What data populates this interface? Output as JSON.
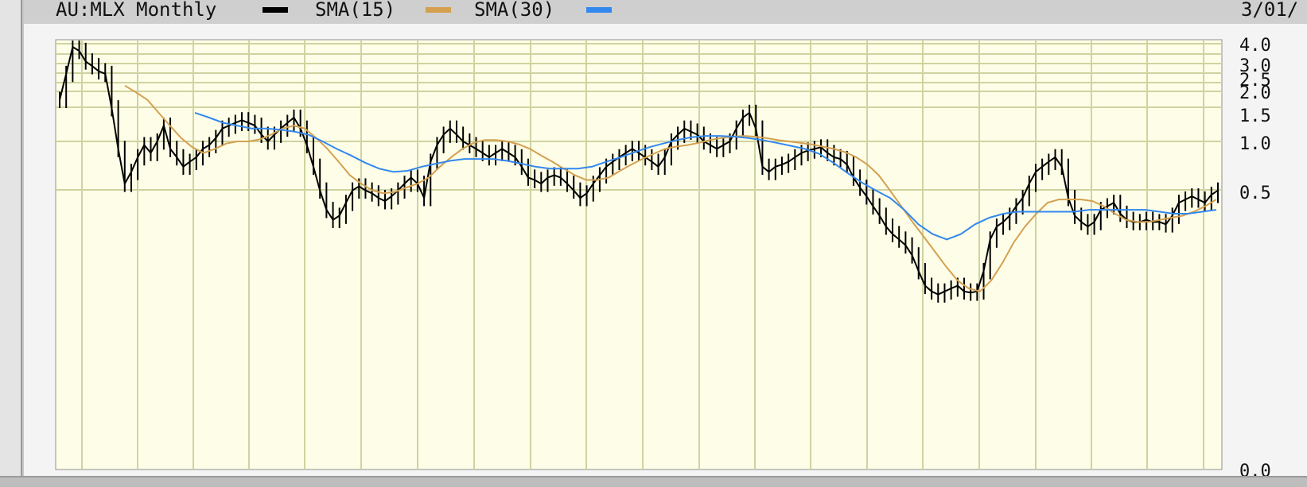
{
  "legend": {
    "title": "AU:MLX Monthly",
    "sma15_label": "SMA(15)",
    "sma30_label": "SMA(30)",
    "date_label": "3/01/"
  },
  "colors": {
    "background": "#fefee8",
    "grid": "#cfd3a0",
    "price": "#000000",
    "sma15": "#d4a050",
    "sma30": "#3388ee"
  },
  "chart_data": {
    "type": "line",
    "title": "AU:MLX Monthly",
    "y_scale": "log",
    "y_tick_labels": [
      "4.0",
      "3.0",
      "2.5",
      "2.0",
      "1.5",
      "1.0",
      "0.5",
      "0.0"
    ],
    "grid": true,
    "legend_position": "top-left",
    "series": [
      {
        "name": "AU:MLX Monthly",
        "values": [
          1.8,
          2.6,
          3.8,
          3.6,
          3.1,
          2.9,
          2.7,
          2.6,
          1.6,
          0.9,
          0.55,
          0.65,
          0.8,
          0.95,
          0.85,
          1.0,
          1.25,
          0.9,
          0.8,
          0.7,
          0.75,
          0.8,
          0.9,
          0.95,
          1.05,
          1.2,
          1.25,
          1.3,
          1.35,
          1.3,
          1.25,
          1.1,
          1.0,
          1.1,
          1.2,
          1.3,
          1.4,
          1.2,
          0.95,
          0.7,
          0.5,
          0.38,
          0.33,
          0.35,
          0.42,
          0.5,
          0.53,
          0.5,
          0.48,
          0.45,
          0.43,
          0.46,
          0.5,
          0.55,
          0.6,
          0.55,
          0.45,
          0.75,
          0.95,
          1.1,
          1.2,
          1.1,
          1.0,
          0.95,
          0.9,
          0.85,
          0.8,
          0.85,
          0.9,
          0.85,
          0.8,
          0.7,
          0.6,
          0.58,
          0.55,
          0.6,
          0.62,
          0.6,
          0.55,
          0.5,
          0.45,
          0.48,
          0.55,
          0.62,
          0.7,
          0.75,
          0.8,
          0.85,
          0.9,
          0.85,
          0.8,
          0.75,
          0.7,
          0.8,
          1.0,
          1.1,
          1.2,
          1.15,
          1.1,
          1.0,
          0.95,
          0.9,
          0.95,
          1.0,
          1.2,
          1.4,
          1.5,
          1.2,
          0.7,
          0.65,
          0.7,
          0.72,
          0.75,
          0.8,
          0.85,
          0.88,
          0.9,
          0.92,
          0.85,
          0.8,
          0.78,
          0.72,
          0.6,
          0.52,
          0.46,
          0.4,
          0.35,
          0.3,
          0.27,
          0.25,
          0.23,
          0.2,
          0.16,
          0.13,
          0.12,
          0.115,
          0.12,
          0.125,
          0.13,
          0.12,
          0.118,
          0.12,
          0.16,
          0.25,
          0.3,
          0.32,
          0.35,
          0.4,
          0.45,
          0.55,
          0.65,
          0.7,
          0.75,
          0.8,
          0.7,
          0.45,
          0.35,
          0.32,
          0.3,
          0.32,
          0.38,
          0.4,
          0.42,
          0.36,
          0.33,
          0.32,
          0.32,
          0.33,
          0.32,
          0.32,
          0.31,
          0.35,
          0.42,
          0.44,
          0.46,
          0.44,
          0.42,
          0.47,
          0.5
        ]
      },
      {
        "name": "SMA(15)",
        "values": [
          2.2,
          2.0,
          1.8,
          1.5,
          1.25,
          1.05,
          0.92,
          0.85,
          0.9,
          0.97,
          1.0,
          1.0,
          1.03,
          1.1,
          1.2,
          1.25,
          1.2,
          1.05,
          0.9,
          0.75,
          0.62,
          0.55,
          0.5,
          0.48,
          0.49,
          0.52,
          0.55,
          0.6,
          0.7,
          0.8,
          0.9,
          0.98,
          1.02,
          1.02,
          1.0,
          0.96,
          0.9,
          0.82,
          0.75,
          0.68,
          0.62,
          0.58,
          0.58,
          0.6,
          0.66,
          0.72,
          0.78,
          0.84,
          0.9,
          0.93,
          0.95,
          0.98,
          1.02,
          1.05,
          1.07,
          1.08,
          1.07,
          1.05,
          1.02,
          1.0,
          0.98,
          0.96,
          0.93,
          0.9,
          0.86,
          0.8,
          0.72,
          0.62,
          0.5,
          0.4,
          0.32,
          0.26,
          0.21,
          0.17,
          0.14,
          0.125,
          0.12,
          0.14,
          0.18,
          0.24,
          0.3,
          0.36,
          0.42,
          0.44,
          0.44,
          0.44,
          0.43,
          0.4,
          0.36,
          0.33,
          0.32,
          0.32,
          0.33,
          0.34,
          0.35,
          0.37,
          0.4,
          0.44
        ]
      },
      {
        "name": "SMA(30)",
        "values": [
          1.5,
          1.4,
          1.3,
          1.25,
          1.2,
          1.2,
          1.18,
          1.15,
          1.1,
          1.0,
          0.9,
          0.82,
          0.74,
          0.68,
          0.65,
          0.66,
          0.7,
          0.73,
          0.76,
          0.78,
          0.78,
          0.78,
          0.76,
          0.73,
          0.7,
          0.68,
          0.68,
          0.68,
          0.7,
          0.75,
          0.8,
          0.86,
          0.92,
          0.97,
          1.02,
          1.06,
          1.08,
          1.08,
          1.07,
          1.05,
          1.02,
          0.98,
          0.94,
          0.9,
          0.84,
          0.74,
          0.64,
          0.56,
          0.5,
          0.45,
          0.38,
          0.31,
          0.27,
          0.25,
          0.27,
          0.31,
          0.34,
          0.36,
          0.37,
          0.37,
          0.37,
          0.37,
          0.37,
          0.38,
          0.38,
          0.38,
          0.38,
          0.38,
          0.37,
          0.36,
          0.36,
          0.37,
          0.38
        ]
      }
    ]
  }
}
